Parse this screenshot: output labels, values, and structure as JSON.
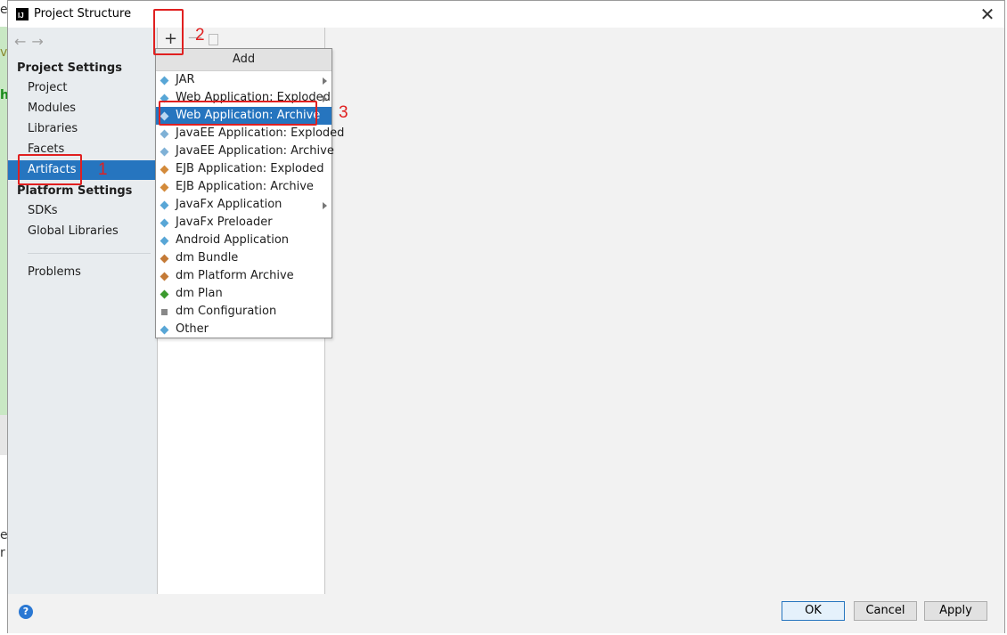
{
  "window": {
    "title": "Project Structure",
    "app_icon_text": "IJ"
  },
  "background_window": {
    "fragments": [
      "e",
      "v",
      "h",
      "e",
      "r"
    ]
  },
  "sidebar": {
    "project_settings_heading": "Project Settings",
    "project_settings_items": [
      {
        "label": "Project"
      },
      {
        "label": "Modules"
      },
      {
        "label": "Libraries"
      },
      {
        "label": "Facets"
      },
      {
        "label": "Artifacts",
        "selected": true
      }
    ],
    "platform_settings_heading": "Platform Settings",
    "platform_settings_items": [
      {
        "label": "SDKs"
      },
      {
        "label": "Global Libraries"
      }
    ],
    "problems_label": "Problems"
  },
  "toolbar": {
    "add_symbol": "+",
    "remove_symbol": "—"
  },
  "add_popup": {
    "header": "Add",
    "items": [
      {
        "label": "JAR",
        "icon": "diamond-icon",
        "submenu": true
      },
      {
        "label": "Web Application: Exploded",
        "icon": "web-diamond-icon",
        "submenu": true
      },
      {
        "label": "Web Application: Archive",
        "icon": "web-archive-icon",
        "selected": true
      },
      {
        "label": "JavaEE Application: Exploded",
        "icon": "javaee-icon"
      },
      {
        "label": "JavaEE Application: Archive",
        "icon": "javaee-icon"
      },
      {
        "label": "EJB Application: Exploded",
        "icon": "ejb-icon"
      },
      {
        "label": "EJB Application: Archive",
        "icon": "ejb-icon"
      },
      {
        "label": "JavaFx Application",
        "icon": "diamond-icon",
        "submenu": true
      },
      {
        "label": "JavaFx Preloader",
        "icon": "diamond-icon"
      },
      {
        "label": "Android Application",
        "icon": "diamond-icon"
      },
      {
        "label": "dm Bundle",
        "icon": "dm-bundle-icon"
      },
      {
        "label": "dm Platform Archive",
        "icon": "dm-archive-icon"
      },
      {
        "label": "dm Plan",
        "icon": "dm-plan-icon"
      },
      {
        "label": "dm Configuration",
        "icon": "dm-config-icon"
      },
      {
        "label": "Other",
        "icon": "diamond-icon"
      }
    ]
  },
  "annotations": [
    {
      "label": "1"
    },
    {
      "label": "2"
    },
    {
      "label": "3"
    }
  ],
  "footer": {
    "help_symbol": "?",
    "ok_label": "OK",
    "cancel_label": "Cancel",
    "apply_label": "Apply"
  },
  "colors": {
    "selection": "#2675bf",
    "annotation": "#e02020",
    "sidebar_bg": "#e8ecef"
  }
}
